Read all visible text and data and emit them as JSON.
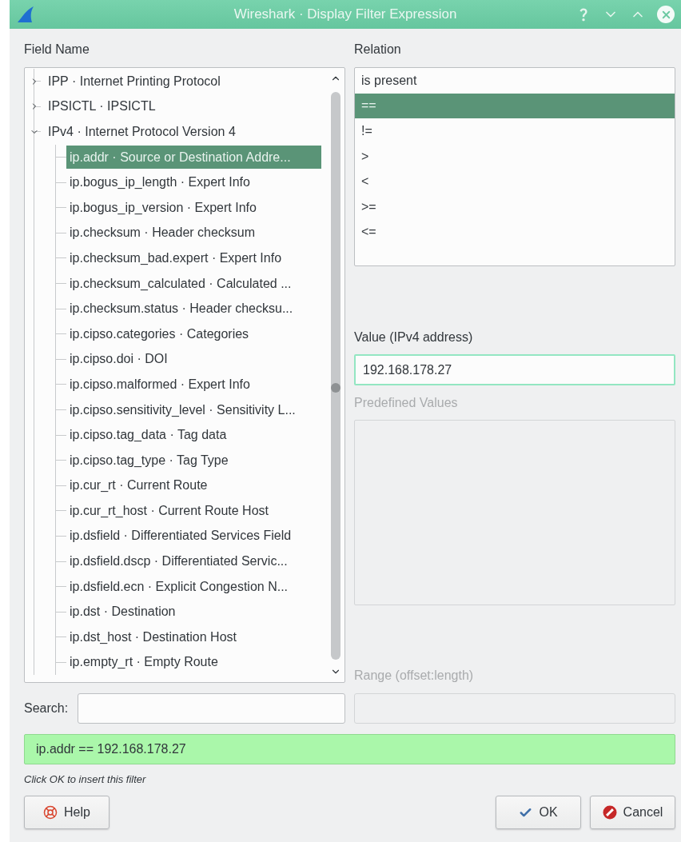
{
  "window": {
    "title": "Wireshark · Display Filter Expression"
  },
  "field_name": {
    "label": "Field Name",
    "tree": [
      {
        "label": "IPP · Internet Printing Protocol",
        "expanded": false,
        "selected": false
      },
      {
        "label": "IPSICTL · IPSICTL",
        "expanded": false,
        "selected": false
      },
      {
        "label": "IPv4 · Internet Protocol Version 4",
        "expanded": true,
        "selected": false,
        "children": [
          {
            "label": "ip.addr · Source or Destination Addre...",
            "selected": true
          },
          {
            "label": "ip.bogus_ip_length · Expert Info",
            "selected": false
          },
          {
            "label": "ip.bogus_ip_version · Expert Info",
            "selected": false
          },
          {
            "label": "ip.checksum · Header checksum",
            "selected": false
          },
          {
            "label": "ip.checksum_bad.expert · Expert Info",
            "selected": false
          },
          {
            "label": "ip.checksum_calculated · Calculated ...",
            "selected": false
          },
          {
            "label": "ip.checksum.status · Header checksu...",
            "selected": false
          },
          {
            "label": "ip.cipso.categories · Categories",
            "selected": false
          },
          {
            "label": "ip.cipso.doi · DOI",
            "selected": false
          },
          {
            "label": "ip.cipso.malformed · Expert Info",
            "selected": false
          },
          {
            "label": "ip.cipso.sensitivity_level · Sensitivity L...",
            "selected": false
          },
          {
            "label": "ip.cipso.tag_data · Tag data",
            "selected": false
          },
          {
            "label": "ip.cipso.tag_type · Tag Type",
            "selected": false
          },
          {
            "label": "ip.cur_rt · Current Route",
            "selected": false
          },
          {
            "label": "ip.cur_rt_host · Current Route Host",
            "selected": false
          },
          {
            "label": "ip.dsfield · Differentiated Services Field",
            "selected": false
          },
          {
            "label": "ip.dsfield.dscp · Differentiated Servic...",
            "selected": false
          },
          {
            "label": "ip.dsfield.ecn · Explicit Congestion N...",
            "selected": false
          },
          {
            "label": "ip.dst · Destination",
            "selected": false
          },
          {
            "label": "ip.dst_host · Destination Host",
            "selected": false
          },
          {
            "label": "ip.empty_rt · Empty Route",
            "selected": false
          }
        ]
      }
    ]
  },
  "relation": {
    "label": "Relation",
    "items": [
      {
        "label": "is present",
        "selected": false
      },
      {
        "label": "==",
        "selected": true
      },
      {
        "label": "!=",
        "selected": false
      },
      {
        "label": ">",
        "selected": false
      },
      {
        "label": "<",
        "selected": false
      },
      {
        "label": ">=",
        "selected": false
      },
      {
        "label": "<=",
        "selected": false
      }
    ]
  },
  "value": {
    "label": "Value (IPv4 address)",
    "value": "192.168.178.27"
  },
  "predefined_values": {
    "label": "Predefined Values",
    "disabled": true
  },
  "range": {
    "label": "Range (offset:length)",
    "disabled": true
  },
  "search": {
    "label": "Search:"
  },
  "filter": {
    "text": "ip.addr == 192.168.178.27",
    "valid": true
  },
  "hint": "Click OK to insert this filter",
  "buttons": [
    {
      "label": "Help",
      "kind": "help"
    },
    {
      "label": "OK",
      "kind": "ok"
    },
    {
      "label": "Cancel",
      "kind": "cancel"
    }
  ]
}
